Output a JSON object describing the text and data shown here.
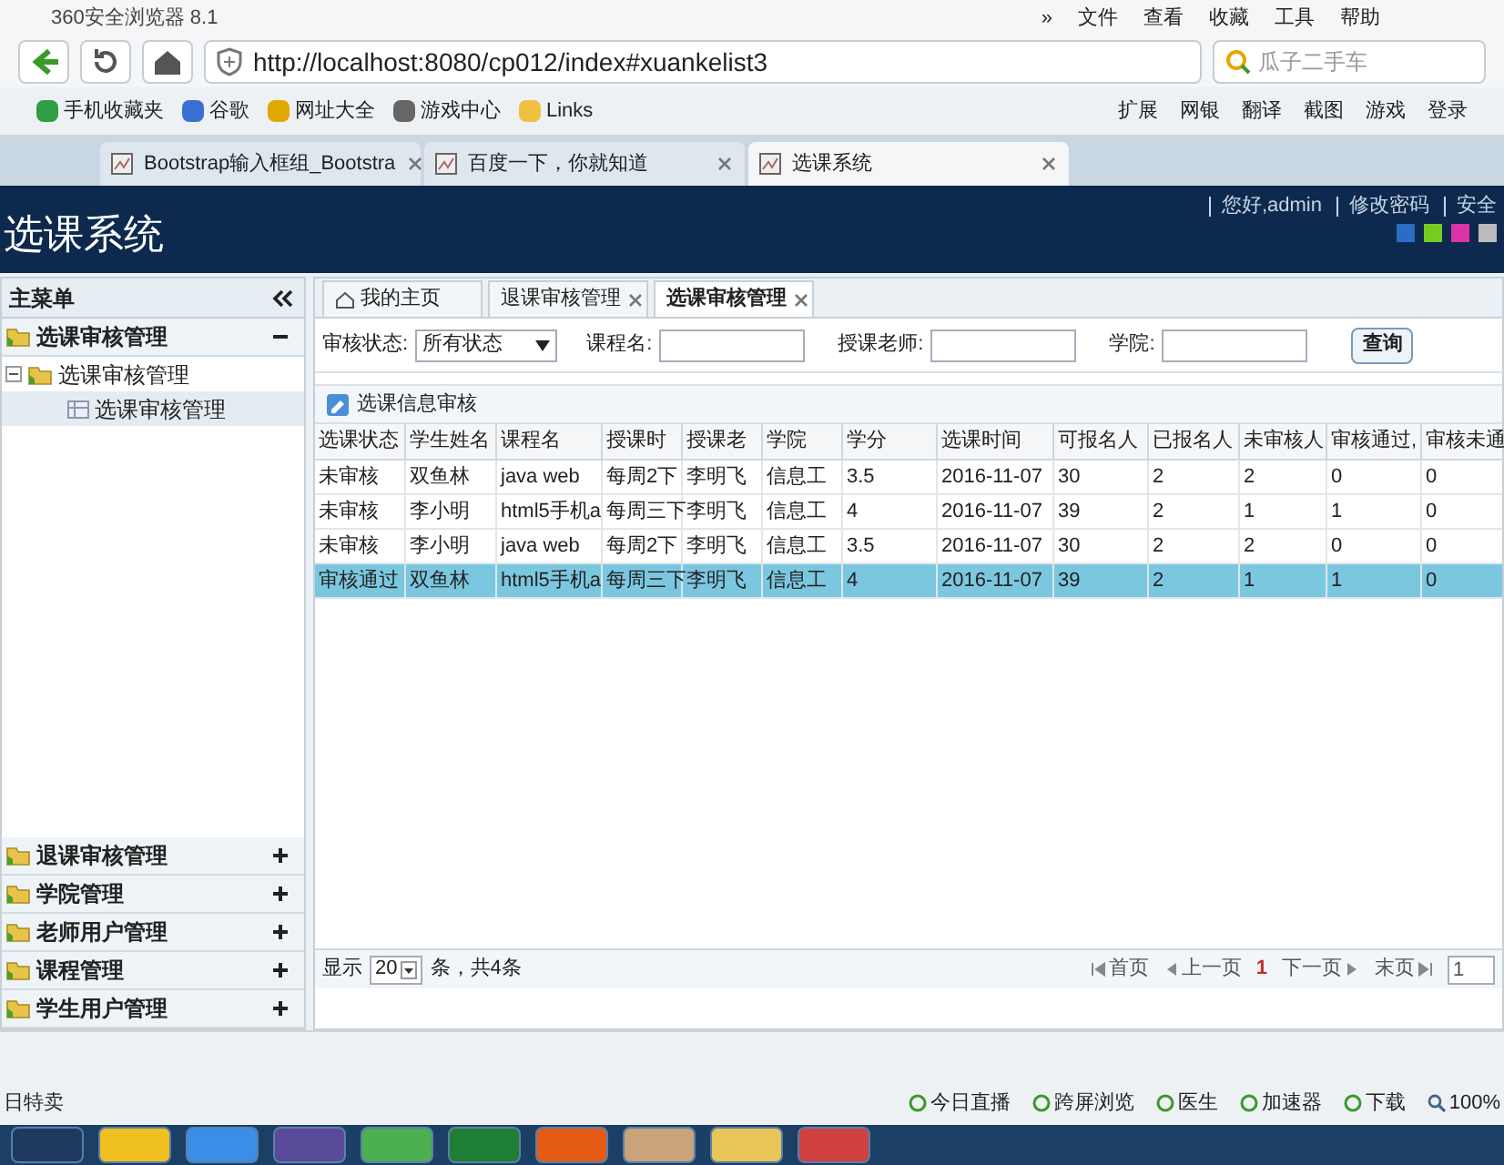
{
  "browser": {
    "title": "360安全浏览器 8.1",
    "menu": [
      "»",
      "文件",
      "查看",
      "收藏",
      "工具",
      "帮助"
    ],
    "address": "http://localhost:8080/cp012/index#xuankelist3",
    "search_placeholder": "瓜子二手车",
    "bookmarks": [
      {
        "label": "手机收藏夹",
        "color": "#2f9e44"
      },
      {
        "label": "谷歌",
        "color": "#3b6fd4"
      },
      {
        "label": "网址大全",
        "color": "#e0a800"
      },
      {
        "label": "游戏中心",
        "color": "#666666"
      },
      {
        "label": "Links",
        "color": "#f0c040"
      }
    ],
    "tools": [
      "扩展",
      "网银",
      "翻译",
      "截图",
      "游戏",
      "登录"
    ],
    "tabs": [
      {
        "label": "Bootstrap输入框组_Bootstra",
        "selected": false
      },
      {
        "label": "百度一下，你就知道",
        "selected": false
      },
      {
        "label": "选课系统",
        "selected": true
      }
    ]
  },
  "app": {
    "title": "选课系统",
    "user_links": [
      "您好,admin",
      "修改密码",
      "安全"
    ],
    "themes": [
      {
        "color": "#2b6cc4"
      },
      {
        "color": "#77cc22"
      },
      {
        "color": "#dd33aa"
      },
      {
        "color": "#bbbbbb"
      }
    ]
  },
  "sidebar": {
    "title": "主菜单",
    "groups": [
      {
        "label": "选课审核管理",
        "expanded": true,
        "children": [
          {
            "label": "选课审核管理",
            "children": [
              {
                "label": "选课审核管理",
                "selected": true
              }
            ]
          }
        ]
      },
      {
        "label": "退课审核管理",
        "expanded": false
      },
      {
        "label": "学院管理",
        "expanded": false
      },
      {
        "label": "老师用户管理",
        "expanded": false
      },
      {
        "label": "课程管理",
        "expanded": false
      },
      {
        "label": "学生用户管理",
        "expanded": false
      }
    ]
  },
  "page_tabs": [
    {
      "label": "我的主页",
      "selected": false,
      "closable": false
    },
    {
      "label": "退课审核管理",
      "selected": false,
      "closable": true
    },
    {
      "label": "选课审核管理",
      "selected": true,
      "closable": true
    }
  ],
  "filters": {
    "status_label": "审核状态:",
    "status_value": "所有状态",
    "course_label": "课程名:",
    "teacher_label": "授课老师:",
    "college_label": "学院:",
    "search_button": "查询"
  },
  "panel_title": "选课信息审核",
  "table": {
    "columns": [
      "选课状态",
      "学生姓名",
      "课程名",
      "授课时",
      "授课老",
      "学院",
      "学分",
      "选课时间",
      "可报名人",
      "已报名人",
      "未审核人",
      "审核通过,",
      "审核未通"
    ],
    "rows": [
      {
        "selected": false,
        "cells": [
          "未审核",
          "双鱼林",
          "java web",
          "每周2下",
          "李明飞",
          "信息工",
          "3.5",
          "2016-11-07",
          "30",
          "2",
          "2",
          "0",
          "0"
        ]
      },
      {
        "selected": false,
        "cells": [
          "未审核",
          "李小明",
          "html5手机a",
          "每周三下",
          "李明飞",
          "信息工",
          "4",
          "2016-11-07",
          "39",
          "2",
          "1",
          "1",
          "0"
        ]
      },
      {
        "selected": false,
        "cells": [
          "未审核",
          "李小明",
          "java web",
          "每周2下",
          "李明飞",
          "信息工",
          "3.5",
          "2016-11-07",
          "30",
          "2",
          "2",
          "0",
          "0"
        ]
      },
      {
        "selected": true,
        "cells": [
          "审核通过",
          "双鱼林",
          "html5手机a",
          "每周三下",
          "李明飞",
          "信息工",
          "4",
          "2016-11-07",
          "39",
          "2",
          "1",
          "1",
          "0"
        ]
      }
    ]
  },
  "pager": {
    "show_label": "显示",
    "page_size": "20",
    "total": "条，共4条",
    "first": "首页",
    "prev": "上一页",
    "current": "1",
    "next": "下一页",
    "last": "末页",
    "page_input": "1"
  },
  "status_bar": {
    "left": "日特卖",
    "items": [
      "今日直播",
      "跨屏浏览",
      "医生",
      "加速器",
      "下载"
    ],
    "zoom": "100%"
  }
}
